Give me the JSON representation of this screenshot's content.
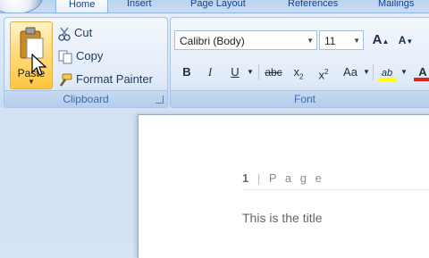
{
  "tabs": [
    "Home",
    "Insert",
    "Page Layout",
    "References",
    "Mailings"
  ],
  "clipboard": {
    "paste_label": "Paste",
    "cut_label": "Cut",
    "copy_label": "Copy",
    "format_painter_label": "Format Painter",
    "group_label": "Clipboard"
  },
  "font": {
    "font_name": "Calibri (Body)",
    "font_size": "11",
    "group_label": "Font",
    "bold": "B",
    "italic": "I",
    "underline": "U",
    "strikethrough": "abc",
    "subscript": "x",
    "subscript_mark": "2",
    "superscript": "x",
    "superscript_mark": "2",
    "change_case": "Aa",
    "grow_font": "A",
    "shrink_font": "A",
    "highlight": "ab",
    "font_color": "A"
  },
  "document": {
    "page_number": "1",
    "page_word": "P a g e",
    "title": "This is the title"
  },
  "colors": {
    "highlight_bar": "#ffff00",
    "font_color_bar": "#e02020"
  }
}
